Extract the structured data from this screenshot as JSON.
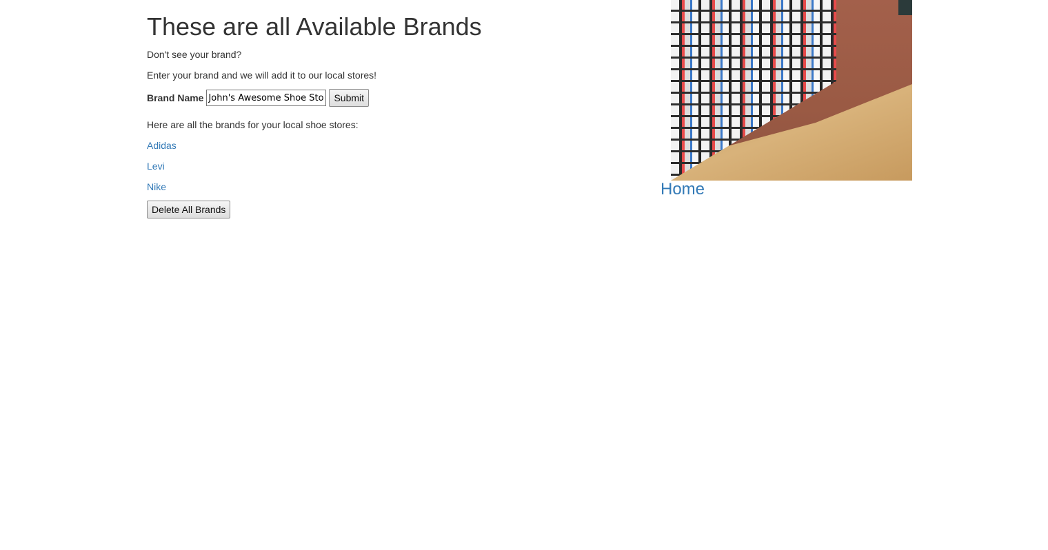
{
  "page": {
    "title": "These are all Available Brands",
    "prompt": "Don't see your brand?",
    "instructions": "Enter your brand and we will add it to our local stores!"
  },
  "form": {
    "label": "Brand Name",
    "input_value": "John's Awesome Shoe Store",
    "submit_label": "Submit"
  },
  "brands": {
    "intro": "Here are all the brands for your local shoe stores:",
    "items": [
      "Adidas",
      "Levi",
      "Nike"
    ],
    "delete_label": "Delete All Brands"
  },
  "nav": {
    "home_label": "Home"
  },
  "image": {
    "subject": "shoe-store-wall-photo"
  },
  "colors": {
    "link": "#337ab7",
    "text": "#333333"
  }
}
